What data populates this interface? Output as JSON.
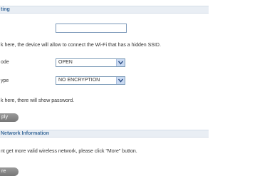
{
  "settings_section": {
    "title": "ting",
    "hidden_ssid_hint": "k here, the device will allow to connect the Wi-Fi that has a hidden SSID.",
    "mode_label": "ode",
    "mode_value": "OPEN",
    "type_label": "ype",
    "type_value": "NO ENCRYPTION",
    "password_hint": "k here, there will show password.",
    "apply_label": "ply"
  },
  "network_section": {
    "title": "Network Information",
    "hint": "nt get more valid wireless network, please click \"More\" button.",
    "more_label": "re"
  }
}
